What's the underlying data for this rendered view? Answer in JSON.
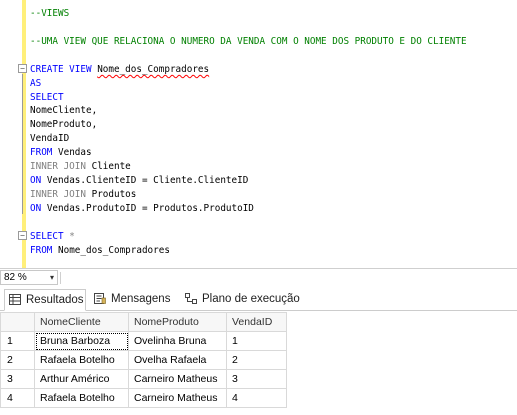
{
  "editor": {
    "comment_views": "--VIEWS",
    "comment_desc": "--UMA VIEW QUE RELACIONA O NUMERO DA VENDA COM O NOME DOS PRODUTO E DO CLIENTE",
    "create_kw": "CREATE VIEW",
    "view_name": "Nome_dos_Compradores",
    "as_kw": "AS",
    "select_kw": "SELECT",
    "col1": "NomeCliente,",
    "col2": "NomeProduto,",
    "col3": "VendaID",
    "from_kw": "FROM",
    "from_table": "Vendas",
    "join1_kw": "INNER JOIN",
    "join1_table": "Cliente",
    "on_kw": "ON",
    "on1_expr": "Vendas.ClienteID = Cliente.ClienteID",
    "join2_kw": "INNER JOIN",
    "join2_table": "Produtos",
    "on2_expr": "Vendas.ProdutoID = Produtos.ProdutoID",
    "select2_kw": "SELECT",
    "star": "*",
    "from2_kw": "FROM",
    "from2_table": "Nome_dos_Compradores"
  },
  "zoom": {
    "value": "82 %",
    "arrow": "▾"
  },
  "tabs": [
    {
      "label": "Resultados",
      "icon": "grid-icon",
      "active": true
    },
    {
      "label": "Mensagens",
      "icon": "messages-icon",
      "active": false
    },
    {
      "label": "Plano de execução",
      "icon": "execution-plan-icon",
      "active": false
    }
  ],
  "results": {
    "columns": [
      "NomeCliente",
      "NomeProduto",
      "VendaID"
    ],
    "rows": [
      {
        "num": "1",
        "cells": [
          "Bruna Barboza",
          "Ovelinha Bruna",
          "1"
        ]
      },
      {
        "num": "2",
        "cells": [
          "Rafaela Botelho",
          "Ovelha Rafaela",
          "2"
        ]
      },
      {
        "num": "3",
        "cells": [
          "Arthur Américo",
          "Carneiro Matheus",
          "3"
        ]
      },
      {
        "num": "4",
        "cells": [
          "Rafaela Botelho",
          "Carneiro Matheus",
          "4"
        ]
      }
    ]
  },
  "colors": {
    "keyword": "#0000ff",
    "comment": "#008000",
    "join_keyword": "#808080",
    "change_bar": "#ffef7a"
  }
}
